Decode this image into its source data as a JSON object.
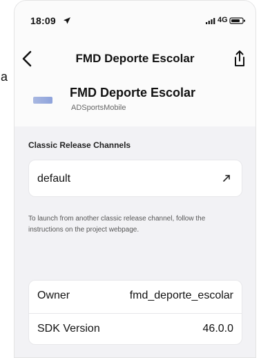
{
  "left_fragment": {
    "text": "a"
  },
  "status_bar": {
    "time": "18:09",
    "network": "4G",
    "icons": {
      "location": "location-arrow",
      "signal": "signal-bars",
      "battery": "battery"
    }
  },
  "navbar": {
    "title": "FMD Deporte Escolar",
    "back_icon": "chevron-left-icon",
    "share_icon": "share-icon"
  },
  "app": {
    "title": "FMD Deporte Escolar",
    "owner": "ADSportsMobile"
  },
  "release_channels": {
    "section_title": "Classic Release Channels",
    "channels": [
      {
        "name": "default",
        "icon": "arrow-up-right-icon"
      }
    ],
    "help_text": "To launch from another classic release channel, follow the instructions on the project webpage."
  },
  "project_info": {
    "rows": [
      {
        "label": "Owner",
        "value": "fmd_deporte_escolar"
      },
      {
        "label": "SDK Version",
        "value": "46.0.0"
      }
    ]
  }
}
